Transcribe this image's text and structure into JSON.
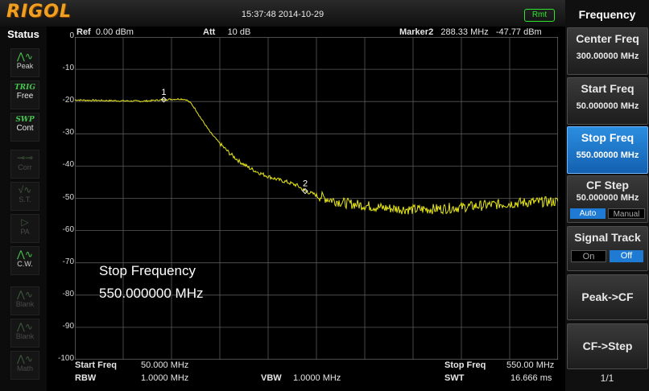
{
  "brand": "RIGOL",
  "datetime": "15:37:48 2014-10-29",
  "remote_badge": "Rmt",
  "status": {
    "title": "Status",
    "items": [
      {
        "label": "Peak",
        "icon": "peak-icon",
        "state": "on"
      },
      {
        "label": "Free",
        "top": "TRIG",
        "icon": "trig-icon",
        "state": "on"
      },
      {
        "label": "Cont",
        "top": "SWP",
        "icon": "sweep-icon",
        "state": "on"
      },
      {
        "label": "Corr",
        "icon": "corr-icon",
        "state": "off"
      },
      {
        "label": "S.T.",
        "icon": "st-icon",
        "state": "off"
      },
      {
        "label": "PA",
        "icon": "pa-icon",
        "state": "off"
      },
      {
        "label": "C.W.",
        "icon": "cw-icon",
        "state": "on"
      },
      {
        "label": "Blank",
        "icon": "blank-icon",
        "state": "off"
      },
      {
        "label": "Blank",
        "icon": "blank-icon",
        "state": "off"
      },
      {
        "label": "Math",
        "icon": "math-icon",
        "state": "off"
      }
    ]
  },
  "header": {
    "ref_label": "Ref",
    "ref_value": "0.00 dBm",
    "att_label": "Att",
    "att_value": "10 dB",
    "marker_label": "Marker2",
    "marker_freq": "288.33 MHz",
    "marker_level": "-47.77 dBm"
  },
  "y_ticks": [
    "0",
    "-10",
    "-20",
    "-30",
    "-40",
    "-50",
    "-60",
    "-70",
    "-80",
    "-90",
    "-100"
  ],
  "overlay": {
    "line1": "Stop Frequency",
    "line2": "550.000000 MHz"
  },
  "footer": {
    "start_label": "Start Freq",
    "start_value": "50.000 MHz",
    "stop_label": "Stop Freq",
    "stop_value": "550.00 MHz",
    "rbw_label": "RBW",
    "rbw_value": "1.0000 MHz",
    "vbw_label": "VBW",
    "vbw_value": "1.0000 MHz",
    "swt_label": "SWT",
    "swt_value": "16.666 ms"
  },
  "chart_data": {
    "type": "line",
    "x_unit": "MHz",
    "y_unit": "dBm",
    "xlim": [
      50,
      550
    ],
    "ylim": [
      -100,
      0
    ],
    "grid": true,
    "series": [
      {
        "color": "#e6e61a",
        "x": [
          50,
          60,
          80,
          100,
          120,
          140,
          150,
          160,
          165,
          170,
          175,
          180,
          190,
          200,
          210,
          220,
          230,
          240,
          250,
          260,
          270,
          280,
          288.33,
          300,
          310,
          320,
          330,
          350,
          370,
          400,
          430,
          460,
          490,
          520,
          550
        ],
        "y": [
          -19.5,
          -19.6,
          -19.7,
          -19.8,
          -19.9,
          -19.5,
          -19.3,
          -19.2,
          -19.4,
          -20.5,
          -22.5,
          -25,
          -29.5,
          -33,
          -36,
          -38.5,
          -40.5,
          -42,
          -43.2,
          -44.2,
          -45,
          -46,
          -47.77,
          -49,
          -50,
          -50.8,
          -51.5,
          -52.2,
          -53,
          -53.5,
          -53.2,
          -52.5,
          -51.8,
          -51.2,
          -51
        ]
      }
    ],
    "markers": [
      {
        "label": "1",
        "x": 142,
        "y": -19.4
      },
      {
        "label": "2",
        "x": 288.33,
        "y": -47.77
      }
    ]
  },
  "menu": {
    "title": "Frequency",
    "center_freq": {
      "label": "Center Freq",
      "value": "300.00000 MHz"
    },
    "start_freq": {
      "label": "Start Freq",
      "value": "50.000000 MHz"
    },
    "stop_freq": {
      "label": "Stop Freq",
      "value": "550.00000 MHz"
    },
    "cf_step": {
      "label": "CF Step",
      "value": "50.000000 MHz",
      "auto": "Auto",
      "manual": "Manual"
    },
    "signal_track": {
      "label": "Signal Track",
      "on": "On",
      "off": "Off"
    },
    "peak_cf": "Peak->CF",
    "cf_step_btn": "CF->Step",
    "page": "1/1"
  },
  "colors": {
    "trace": "#e6e61a",
    "accent": "#1f7ad4",
    "brand": "#f0a020",
    "remote": "#2ee62e"
  }
}
